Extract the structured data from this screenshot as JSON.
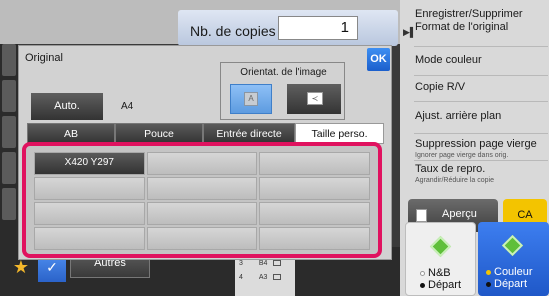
{
  "copies": {
    "label": "Nb. de copies",
    "value": "1"
  },
  "menu": {
    "items": [
      {
        "label": "Enregistrer/Supprimer Format de l'original"
      },
      {
        "label": "Mode couleur"
      },
      {
        "label": "Copie R/V"
      },
      {
        "label": "Ajust. arrière plan"
      },
      {
        "label": "Suppression page vierge",
        "sub": "Ignorer page vierge dans orig."
      },
      {
        "label": "Taux de repro.",
        "sub": "Agrandir/Réduire la copie"
      }
    ]
  },
  "actions": {
    "apercu": "Aperçu",
    "ca": "CA"
  },
  "start": {
    "nb_line1": "N&B",
    "nb_line2": "Départ",
    "color_line1": "Couleur",
    "color_line2": "Départ"
  },
  "bottom": {
    "autres": "Autres",
    "trays": [
      {
        "num": "3",
        "size": "B4"
      },
      {
        "num": "4",
        "size": "A3"
      }
    ]
  },
  "dialog": {
    "title": "Original",
    "ok": "OK",
    "orientation_label": "Orientat. de l'image",
    "orient_glyph_a": "A",
    "orient_glyph_b": "≺",
    "auto_label": "Auto.",
    "auto_size": "A4",
    "tabs": [
      {
        "label": "AB",
        "active": false
      },
      {
        "label": "Pouce",
        "active": false
      },
      {
        "label": "Entrée directe",
        "active": false
      },
      {
        "label": "Taille perso.",
        "active": true
      }
    ],
    "grid_cells": [
      "X420 Y297",
      "",
      "",
      "",
      "",
      "",
      "",
      "",
      "",
      "",
      "",
      ""
    ]
  },
  "colors": {
    "highlight": "#e0125f",
    "accent_blue": "#1b5fcc",
    "ca_yellow": "#f3c400",
    "start_green": "#5fbf3a"
  }
}
